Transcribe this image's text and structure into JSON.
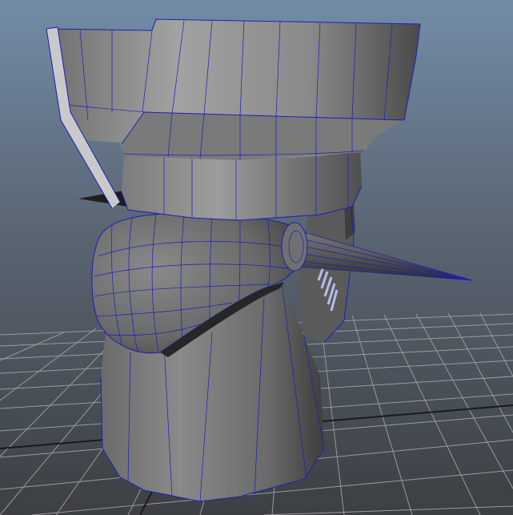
{
  "viewport": {
    "background_top": "#6f8aa3",
    "background_bottom": "#4a4f55",
    "grid_color": "#9a9a9a",
    "wire_color": "#1c1fb8"
  },
  "model": {
    "shade_light": "#8c8c8c",
    "shade_mid": "#6a6a6a",
    "shade_dark": "#3a3a3a"
  }
}
